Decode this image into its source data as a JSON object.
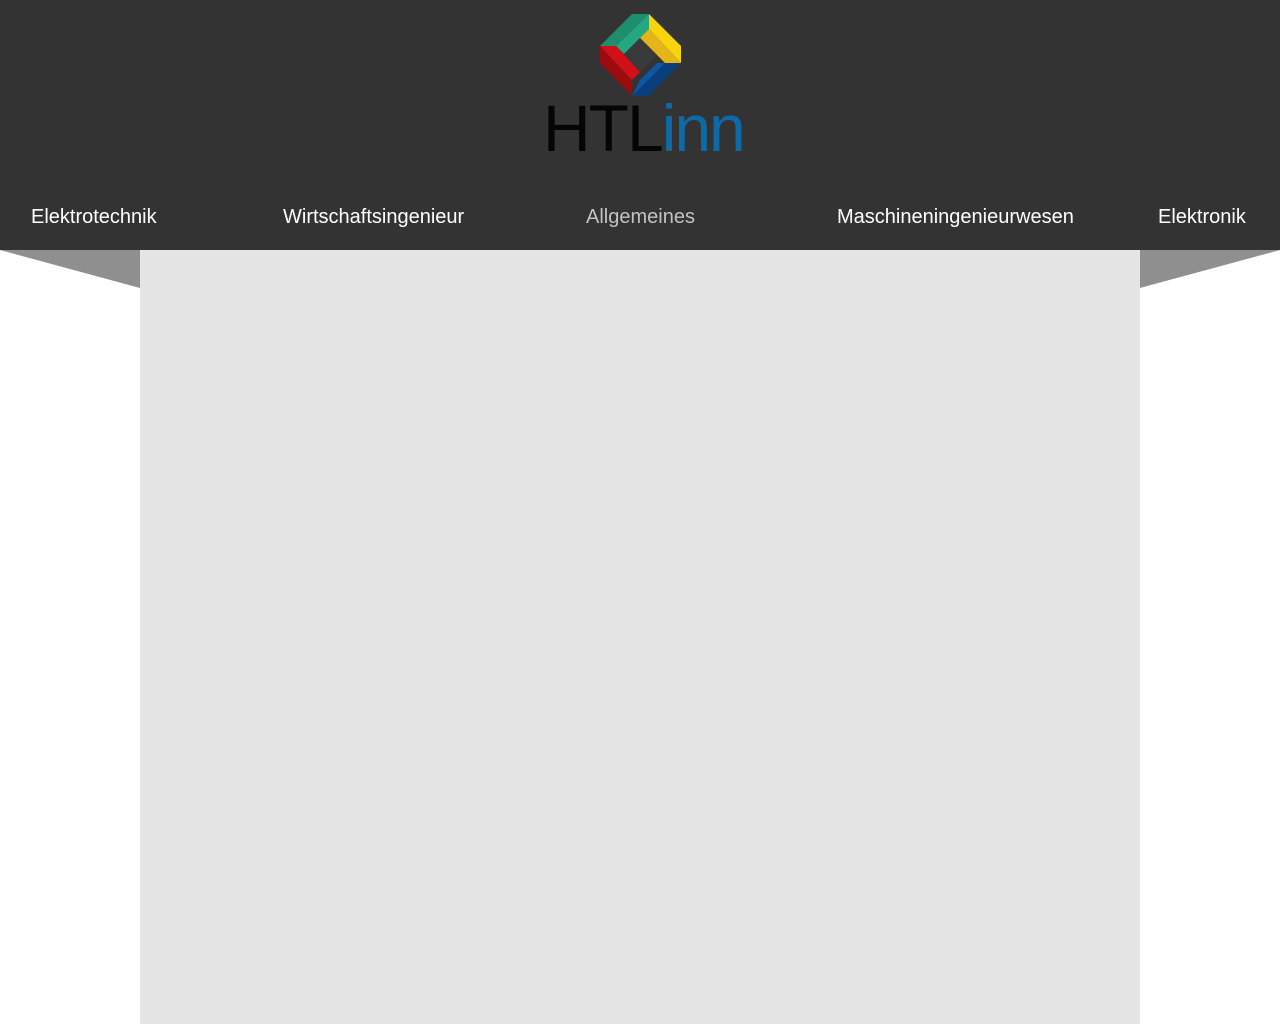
{
  "colors": {
    "header_bg": "#333333",
    "content_bg": "#e5e5e5",
    "wing": "#8f8f8f",
    "nav_text": "#ffffff",
    "nav_active_text": "#c2c2c2",
    "logo_htl": "#050505",
    "logo_inn": "#0e6aa6"
  },
  "logo": {
    "text_part1": "HTL",
    "text_part2": "inn",
    "icon": "cube-frame-logo-icon"
  },
  "nav": {
    "items": [
      {
        "label": "Elektrotechnik",
        "active": false
      },
      {
        "label": "Wirtschaftsingenieur",
        "active": false
      },
      {
        "label": "Allgemeines",
        "active": true
      },
      {
        "label": "Maschineningenieurwesen",
        "active": false
      },
      {
        "label": "Elektronik",
        "active": false
      }
    ]
  }
}
